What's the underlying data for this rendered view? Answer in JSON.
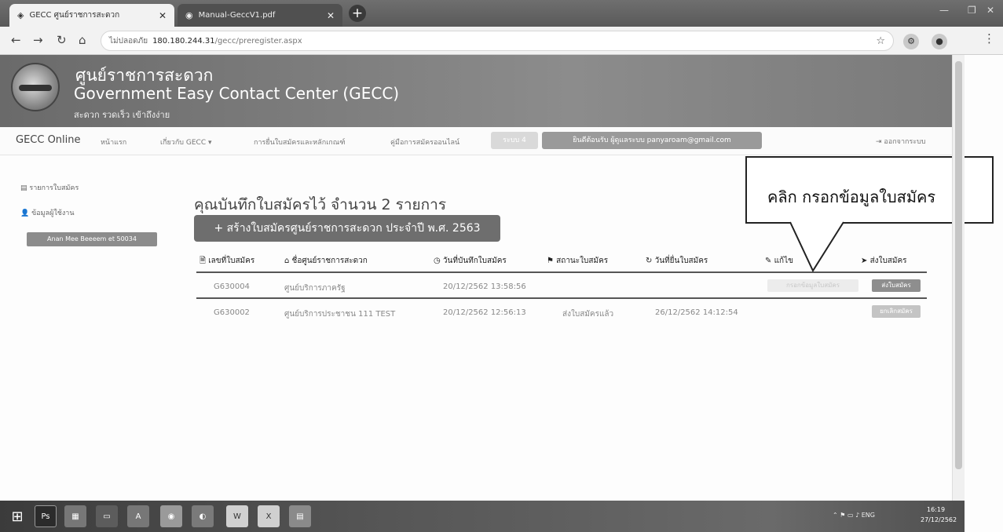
{
  "browser": {
    "tabs": [
      {
        "label": "GECC ศูนย์ราชการสะดวก",
        "icon": "gecc-favicon-icon"
      },
      {
        "label": "Manual-GeccV1.pdf",
        "icon": "chrome-icon"
      }
    ],
    "address": {
      "security": "ไม่ปลอดภัย",
      "host": "180.180.244.31",
      "path": "/gecc/preregister.aspx"
    }
  },
  "site": {
    "title_th": "ศูนย์ราชการสะดวก",
    "title_en": "Government Easy Contact Center (GECC)",
    "slogan": "สะดวก รวดเร็ว เข้าถึงง่าย"
  },
  "navbar": {
    "brand": "GECC Online",
    "items": [
      "หน้าแรก",
      "เกี่ยวกับ GECC",
      "การยื่นใบสมัครและหลักเกณฑ์",
      "คู่มือการสมัครออนไลน์"
    ],
    "badge": "ระบบ 4",
    "email": "ยินดีต้อนรับ ผู้ดูแลระบบ panyaroam@gmail.com",
    "logout": "ออกจากระบบ"
  },
  "sidebar": {
    "items": [
      "รายการใบสมัคร",
      "ข้อมูลผู้ใช้งาน"
    ],
    "user": "Anan Mee Beeeem et 50034"
  },
  "main": {
    "heading": "คุณบันทึกใบสมัครไว้ จำนวน 2 รายการ",
    "create_button": "+ สร้างใบสมัครศูนย์ราชการสะดวก ประจำปี พ.ศ. 2563"
  },
  "table": {
    "headers": [
      "เลขที่ใบสมัคร",
      "ชื่อศูนย์ราชการสะดวก",
      "วันที่บันทึกใบสมัคร",
      "สถานะใบสมัคร",
      "วันที่ยื่นใบสมัคร",
      "แก้ไข",
      "ส่งใบสมัคร"
    ],
    "rows": [
      {
        "no": "G630004",
        "name": "ศูนย์บริการภาครัฐ",
        "saved": "20/12/2562 13:58:56",
        "status": "",
        "submitted": "",
        "edit": "กรอกข้อมูลใบสมัคร",
        "action": "ส่งใบสมัคร"
      },
      {
        "no": "G630002",
        "name": "ศูนย์บริการประชาชน 111 TEST",
        "saved": "20/12/2562 12:56:13",
        "status": "ส่งใบสมัครแล้ว",
        "submitted": "26/12/2562 14:12:54",
        "edit": "",
        "action": "ยกเลิกสมัคร"
      }
    ]
  },
  "callout": {
    "text": "คลิก กรอกข้อมูลใบสมัคร"
  },
  "taskbar": {
    "apps": [
      "Ps",
      "W",
      "X"
    ],
    "tray_lang": "ENG",
    "time": "16:19",
    "date": "27/12/2562"
  }
}
